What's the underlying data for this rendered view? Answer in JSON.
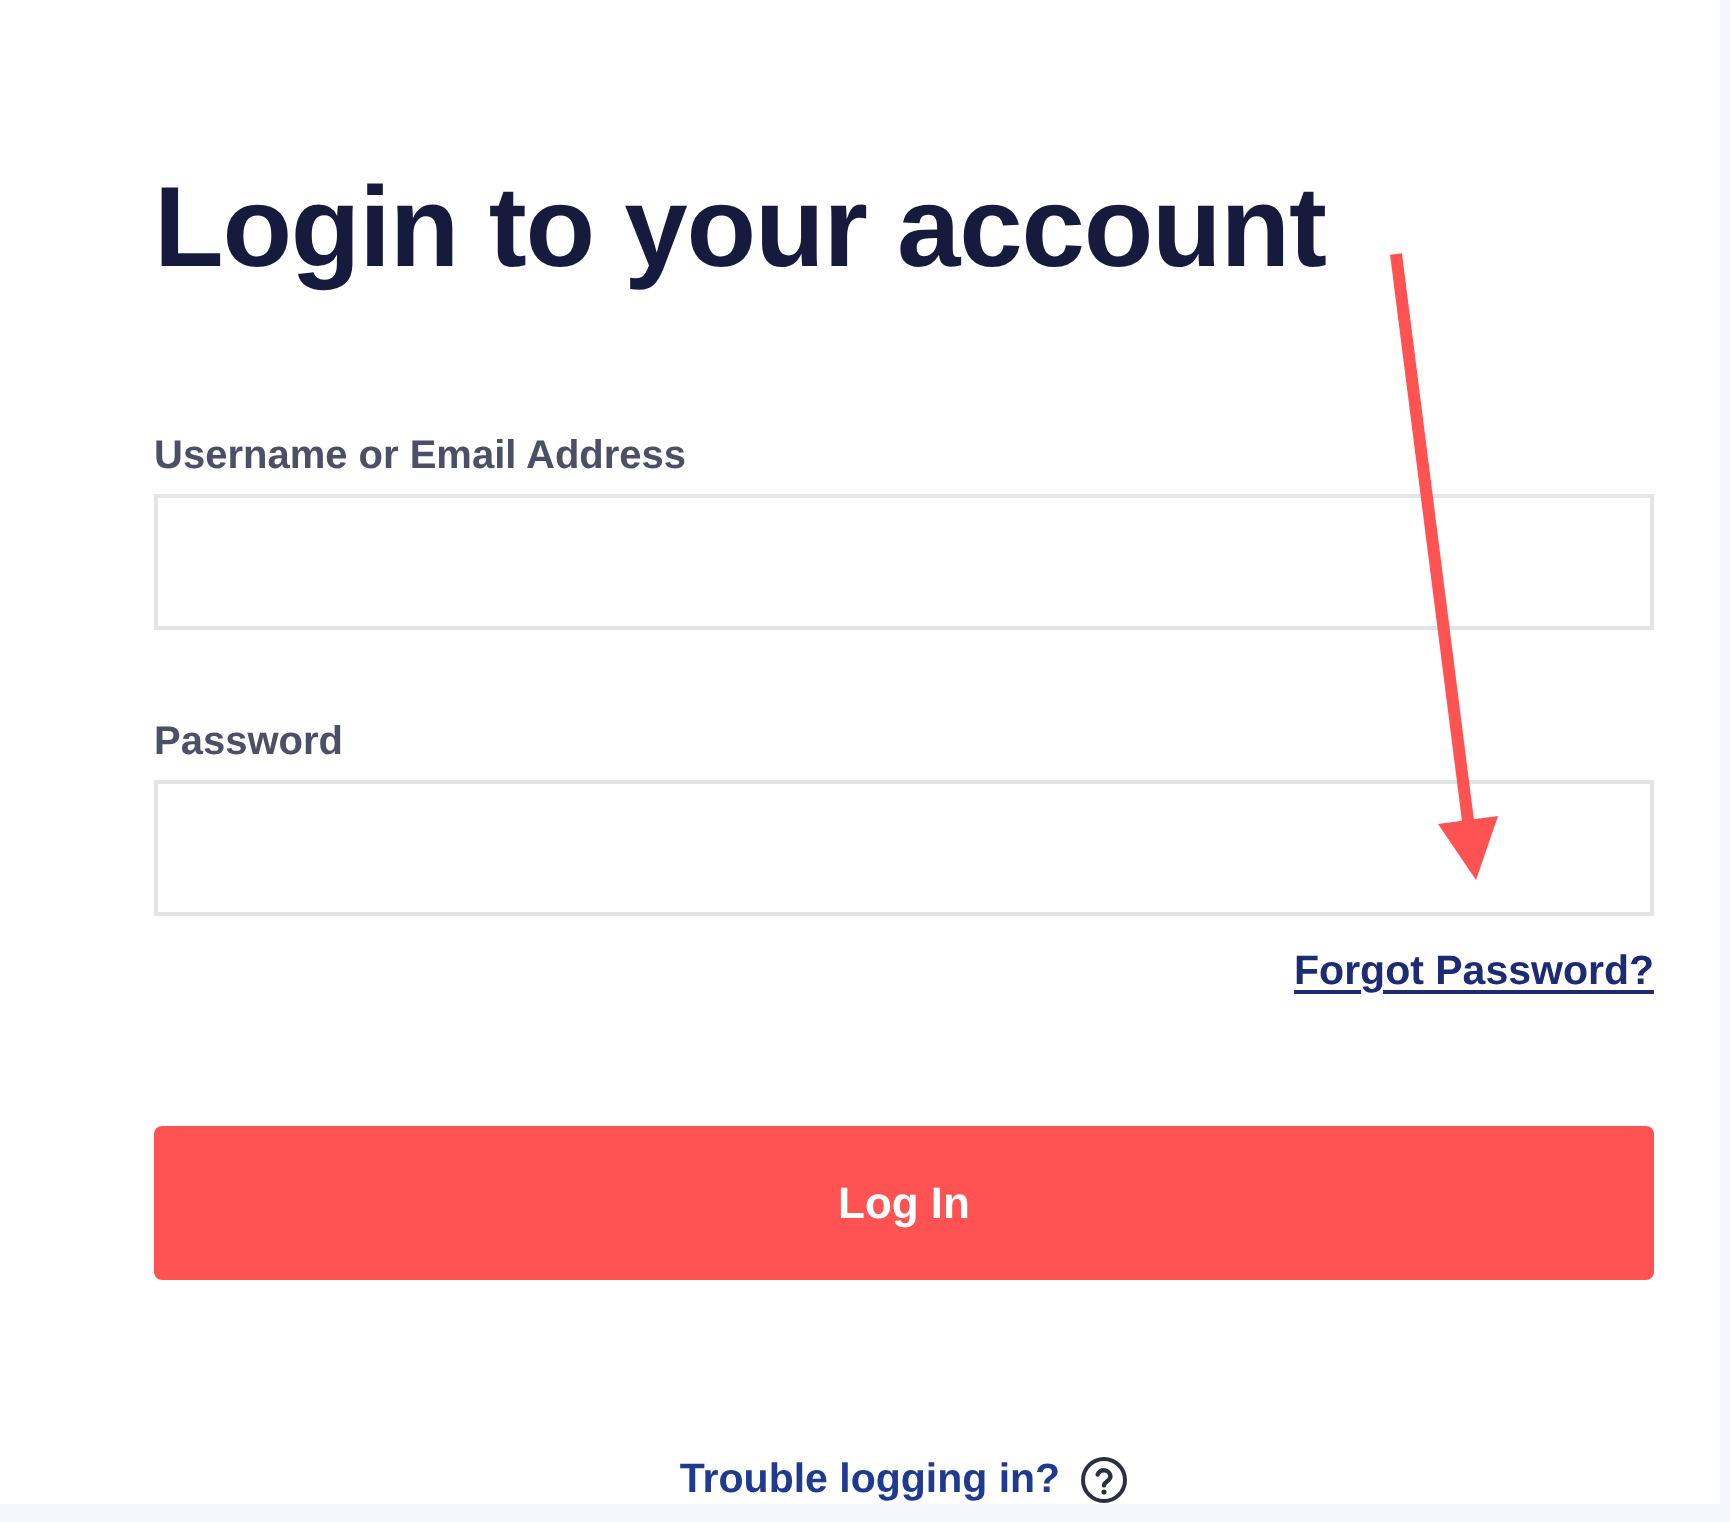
{
  "heading": "Login to your account",
  "fields": [
    {
      "label": "Username or Email Address"
    },
    {
      "label": "Password"
    }
  ],
  "forgot_link": "Forgot Password?",
  "submit_button": "Log In",
  "help_link": "Trouble logging in?"
}
